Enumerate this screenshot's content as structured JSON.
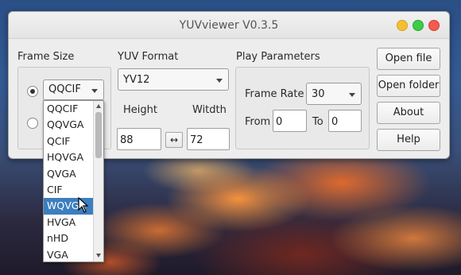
{
  "window": {
    "title": "YUVviewer V0.3.5"
  },
  "frame_size": {
    "label": "Frame Size",
    "selected": "QQCIF",
    "options": [
      "QQCIF",
      "QQVGA",
      "QCIF",
      "HQVGA",
      "QVGA",
      "CIF",
      "WQVGA",
      "HVGA",
      "nHD",
      "VGA"
    ],
    "highlighted_index": 6
  },
  "yuv_format": {
    "label": "YUV Format",
    "selected": "YV12",
    "height_label": "Height",
    "width_label": "Witdth",
    "height_value": "88",
    "width_value": "72",
    "swap_symbol": "↔"
  },
  "play": {
    "label": "Play Parameters",
    "frame_rate_label": "Frame Rate",
    "frame_rate_value": "30",
    "from_label": "From",
    "from_value": "0",
    "to_label": "To",
    "to_value": "0"
  },
  "buttons": {
    "open_file": "Open file",
    "open_folder": "Open folder",
    "about": "About",
    "help": "Help"
  }
}
